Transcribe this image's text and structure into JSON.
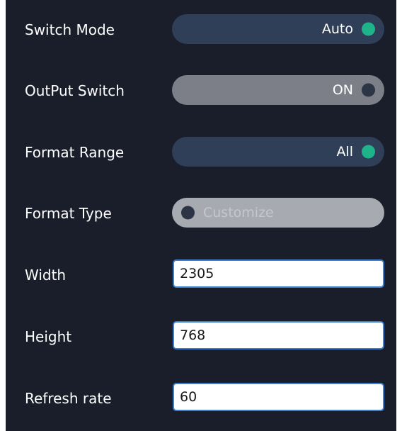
{
  "settings": {
    "switch_mode": {
      "label": "Switch Mode",
      "value": "Auto",
      "knob_color": "#1fb38a"
    },
    "output_switch": {
      "label": "OutPut Switch",
      "value": "ON",
      "knob_color": "#2c3546"
    },
    "format_range": {
      "label": "Format Range",
      "value": "All",
      "knob_color": "#1fb38a"
    },
    "format_type": {
      "label": "Format Type",
      "value": "Customize",
      "knob_color": "#2c3546"
    },
    "width": {
      "label": "Width",
      "value": "2305"
    },
    "height": {
      "label": "Height",
      "value": "768"
    },
    "refresh_rate": {
      "label": "Refresh rate",
      "value": "60"
    }
  },
  "colors": {
    "panel_background": "#1a1e2b",
    "toggle_active": "#2f3f58",
    "toggle_inactive": "#7c7f88",
    "indicator_green": "#1fb38a",
    "input_border": "#3d7fce"
  }
}
